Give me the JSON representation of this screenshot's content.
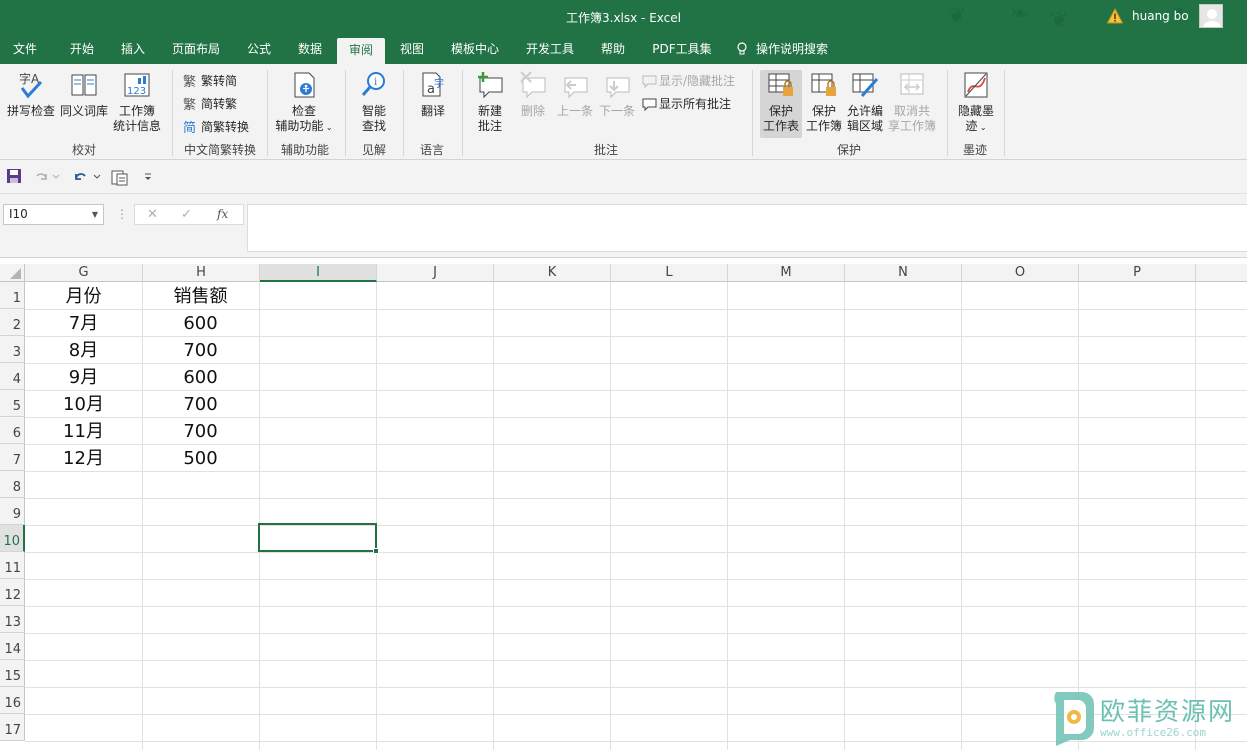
{
  "titlebar": {
    "title": "工作簿3.xlsx  -  Excel",
    "user": "huang bo"
  },
  "tabs": [
    "文件",
    "开始",
    "插入",
    "页面布局",
    "公式",
    "数据",
    "审阅",
    "视图",
    "模板中心",
    "开发工具",
    "帮助",
    "PDF工具集"
  ],
  "active_tab": "审阅",
  "tell_me": "操作说明搜索",
  "ribbon": {
    "proofing": {
      "spelling": "拼写检查",
      "thesaurus": "同义词库",
      "stats_l1": "工作簿",
      "stats_l2": "统计信息",
      "label": "校对"
    },
    "chinese": {
      "to_simplified": "繁转简",
      "to_traditional": "简转繁",
      "convert": "简繁转换",
      "label": "中文简繁转换"
    },
    "accessibility": {
      "l1": "检查",
      "l2": "辅助功能",
      "label": "辅助功能"
    },
    "insights": {
      "l1": "智能",
      "l2": "查找",
      "label": "见解"
    },
    "language": {
      "translate": "翻译",
      "label": "语言"
    },
    "comments": {
      "new_l1": "新建",
      "new_l2": "批注",
      "delete": "删除",
      "previous": "上一条",
      "next": "下一条",
      "show_hide": "显示/隐藏批注",
      "show_all": "显示所有批注",
      "label": "批注"
    },
    "protect": {
      "sheet_l1": "保护",
      "sheet_l2": "工作表",
      "book_l1": "保护",
      "book_l2": "工作簿",
      "ranges_l1": "允许编",
      "ranges_l2": "辑区域",
      "unshare_l1": "取消共",
      "unshare_l2": "享工作簿",
      "label": "保护"
    },
    "ink": {
      "l1": "隐藏墨",
      "l2": "迹",
      "label": "墨迹"
    }
  },
  "namebox": "I10",
  "formula": "",
  "columns": [
    "G",
    "H",
    "I",
    "J",
    "K",
    "L",
    "M",
    "N",
    "O",
    "P"
  ],
  "selected_column": "I",
  "rows": [
    "1",
    "2",
    "3",
    "4",
    "5",
    "6",
    "7",
    "8",
    "9",
    "10",
    "11",
    "12",
    "13",
    "14",
    "15",
    "16",
    "17"
  ],
  "selected_row": "10",
  "sheet": {
    "headers": [
      "月份",
      "销售额"
    ],
    "data": [
      [
        "7月",
        "600"
      ],
      [
        "8月",
        "700"
      ],
      [
        "9月",
        "600"
      ],
      [
        "10月",
        "700"
      ],
      [
        "11月",
        "700"
      ],
      [
        "12月",
        "500"
      ]
    ]
  },
  "watermark": {
    "text": "欧菲资源网",
    "url": "www.office26.com"
  },
  "colors": {
    "brand": "#217346",
    "ribbon_bg": "#f3f3f3",
    "gridline": "#e1e1e1",
    "watermark": "#6cc0b3"
  }
}
